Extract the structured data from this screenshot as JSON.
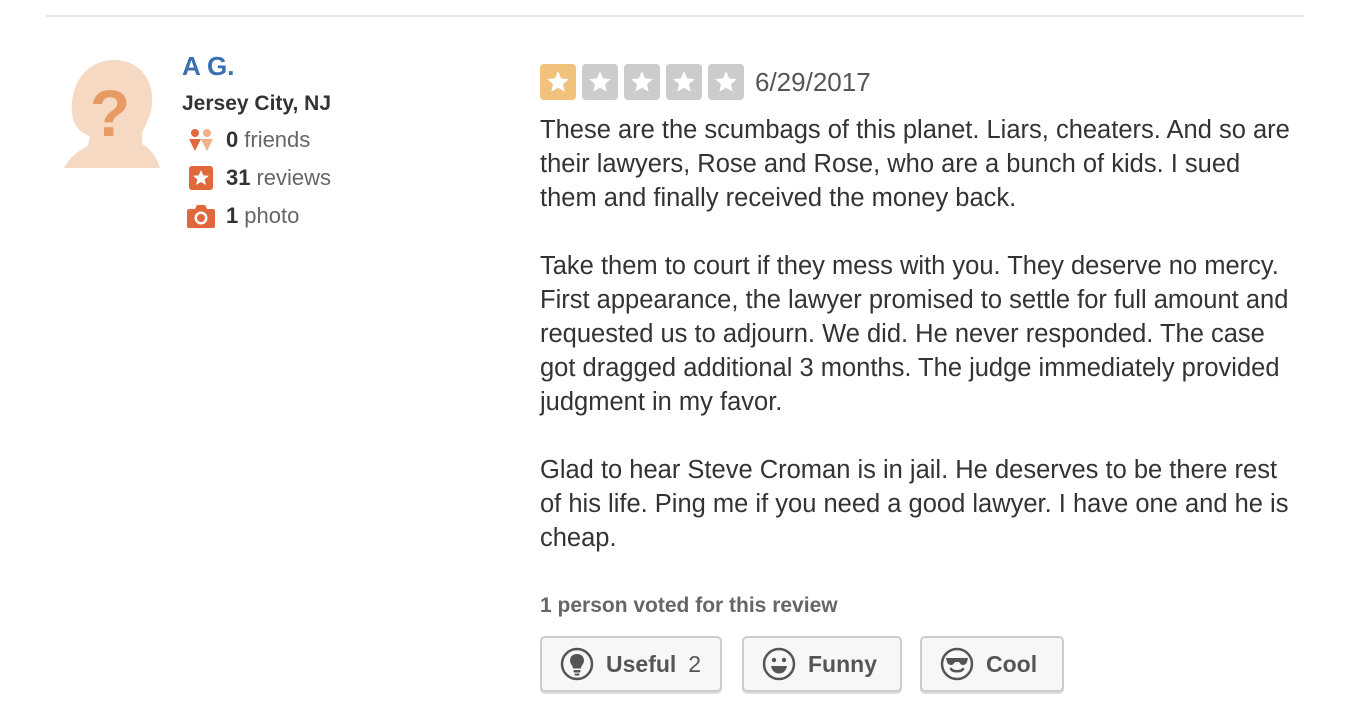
{
  "user": {
    "name": "A G.",
    "location": "Jersey City, NJ",
    "friends_count": "0",
    "friends_label": "friends",
    "reviews_count": "31",
    "reviews_label": "reviews",
    "photos_count": "1",
    "photos_label": "photo"
  },
  "review": {
    "rating": 1,
    "rating_max": 5,
    "date": "6/29/2017",
    "paragraphs": [
      "These are the scumbags of this planet. Liars, cheaters. And so are their lawyers, Rose and Rose, who are a bunch of kids. I sued them and finally received the money back.",
      "Take them to court if they mess with you. They deserve no mercy. First appearance, the lawyer promised to settle for full amount and requested us to adjourn. We did. He never responded. The case got dragged additional 3 months. The judge immediately provided judgment in my favor.",
      "Glad to hear Steve Croman is in jail. He deserves to be there rest of his life. Ping me if you need a good lawyer. I have one and he is cheap."
    ],
    "vote_summary": "1 person voted for this review"
  },
  "votes": {
    "useful_label": "Useful",
    "useful_count": "2",
    "funny_label": "Funny",
    "cool_label": "Cool"
  },
  "colors": {
    "name_link": "#3a6fb0",
    "star_filled": "#f0c27b",
    "star_empty": "#cccccc",
    "stat_icon": "#e0683a",
    "avatar": "#f2c4a4"
  },
  "icons": [
    "default-avatar-icon",
    "friends-icon",
    "review-star-icon",
    "camera-icon",
    "star-icon",
    "lightbulb-icon",
    "smiley-icon",
    "sunglasses-icon"
  ]
}
